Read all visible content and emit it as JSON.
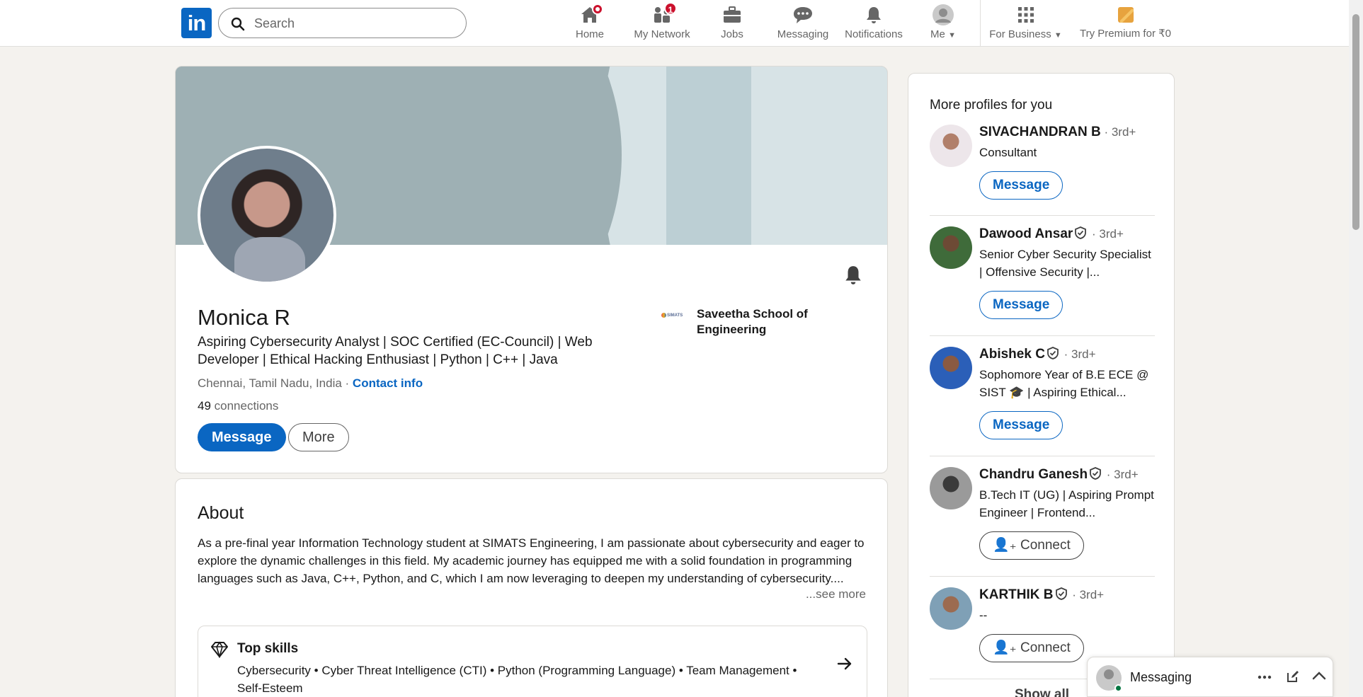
{
  "nav": {
    "logo": "in",
    "search_placeholder": "Search",
    "items": [
      {
        "label": "Home"
      },
      {
        "label": "My Network",
        "badge": "1"
      },
      {
        "label": "Jobs"
      },
      {
        "label": "Messaging"
      },
      {
        "label": "Notifications"
      },
      {
        "label": "Me"
      },
      {
        "label": "For Business"
      },
      {
        "label": "Try Premium for ₹0"
      }
    ]
  },
  "profile": {
    "name": "Monica R",
    "headline": "Aspiring Cybersecurity Analyst | SOC Certified (EC-Council) | Web Developer | Ethical Hacking Enthusiast | Python | C++ | Java",
    "location": "Chennai, Tamil Nadu, India",
    "location_sep": " · ",
    "contact_info": "Contact info",
    "connections_count": "49",
    "connections_label": " connections",
    "message_button": "Message",
    "more_button": "More",
    "education_logo_text": "SIMATS",
    "education": "Saveetha School of Engineering"
  },
  "about": {
    "title": "About",
    "text": "As a pre-final year Information Technology student at SIMATS Engineering, I am passionate about cybersecurity and eager to explore the dynamic challenges in this field. My academic journey has equipped me with a solid foundation in programming languages such as Java, C++, Python, and C, which I am now leveraging to deepen my understanding of cybersecurity....",
    "see_more": "...see more",
    "top_skills_title": "Top skills",
    "top_skills": "Cybersecurity • Cyber Threat Intelligence (CTI) • Python (Programming Language) • Team Management • Self-Esteem"
  },
  "sidebar": {
    "title": "More profiles for you",
    "profiles": [
      {
        "name": "SIVACHANDRAN B",
        "degree": " · 3rd+",
        "headline": "Consultant",
        "action": "Message"
      },
      {
        "name": "Dawood Ansar",
        "degree": " · 3rd+",
        "headline": "Senior Cyber Security Specialist | Offensive Security |...",
        "action": "Message"
      },
      {
        "name": "Abishek C",
        "degree": " · 3rd+",
        "headline": "Sophomore Year of B.E ECE @ SIST 🎓 | Aspiring Ethical...",
        "action": "Message"
      },
      {
        "name": "Chandru Ganesh",
        "degree": " · 3rd+",
        "headline": "B.Tech IT (UG) | Aspiring Prompt Engineer | Frontend...",
        "action": "Connect"
      },
      {
        "name": "KARTHIK B",
        "degree": " · 3rd+",
        "headline": "--",
        "action": "Connect"
      }
    ],
    "show_all": "Show all"
  },
  "messaging_dock": {
    "title": "Messaging"
  },
  "colors": {
    "brand": "#0a66c2",
    "badge": "#cb112d",
    "background": "#f4f2ee"
  }
}
